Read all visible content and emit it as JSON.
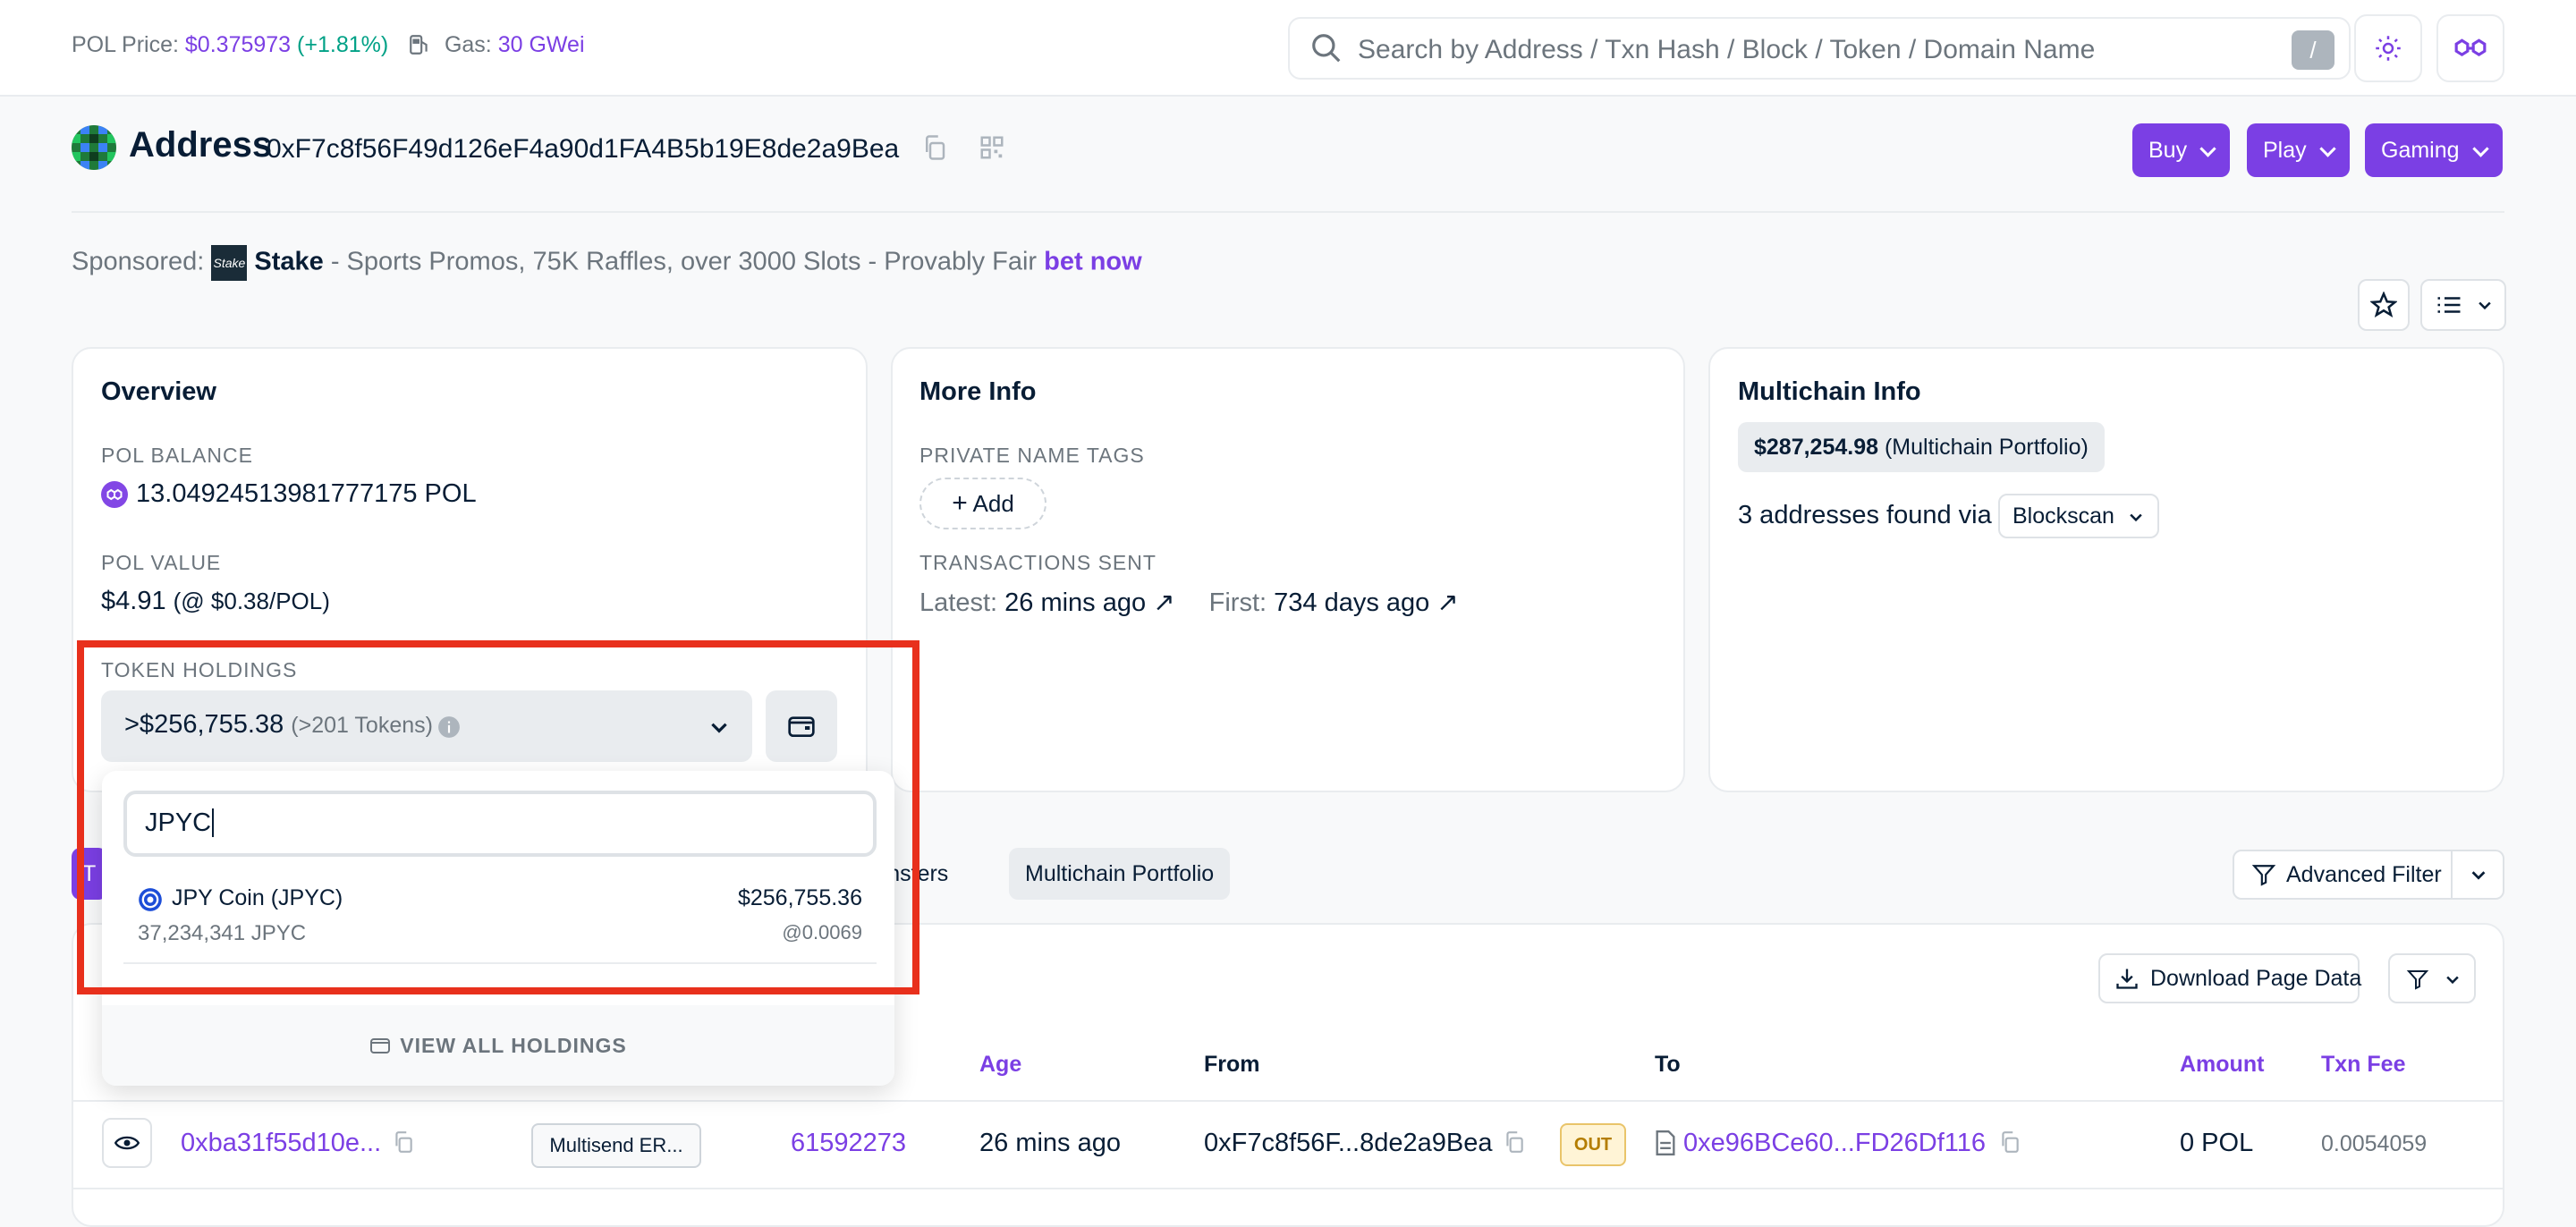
{
  "topbar": {
    "price_label": "POL Price:",
    "price_value": "$0.375973",
    "price_change": "(+1.81%)",
    "gas_label": "Gas:",
    "gas_value": "30 GWei",
    "search_placeholder": "Search by Address / Txn Hash / Block / Token / Domain Name",
    "search_shortcut": "/"
  },
  "header": {
    "title": "Address",
    "address": "0xF7c8f56F49d126eF4a90d1FA4B5b19E8de2a9Bea",
    "buttons": [
      "Buy",
      "Play",
      "Gaming"
    ]
  },
  "sponsor": {
    "label": "Sponsored:",
    "logo_text": "Stake",
    "brand": "Stake",
    "text": "- Sports Promos, 75K Raffles, over 3000 Slots - Provably Fair",
    "link": "bet now"
  },
  "overview": {
    "title": "Overview",
    "balance_label": "POL BALANCE",
    "balance_value": "13.04924513981777175 POL",
    "value_label": "POL VALUE",
    "value_value": "$4.91",
    "value_rate": "(@ $0.38/POL)",
    "holdings_label": "TOKEN HOLDINGS",
    "holdings_value": ">$256,755.38",
    "holdings_count": "(>201 Tokens)"
  },
  "dropdown": {
    "search_value": "JPYC",
    "token_name": "JPY Coin (JPYC)",
    "token_amount": "37,234,341 JPYC",
    "token_value": "$256,755.36",
    "token_rate": "@0.0069",
    "view_all": "VIEW ALL HOLDINGS"
  },
  "moreinfo": {
    "title": "More Info",
    "tags_label": "PRIVATE NAME TAGS",
    "add_label": "Add",
    "sent_label": "TRANSACTIONS SENT",
    "latest_label": "Latest:",
    "latest_value": "26 mins ago",
    "first_label": "First:",
    "first_value": "734 days ago"
  },
  "multichain": {
    "title": "Multichain Info",
    "portfolio_value": "$287,254.98",
    "portfolio_label": "(Multichain Portfolio)",
    "found_text": "3 addresses found via",
    "provider": "Blockscan"
  },
  "tabs": {
    "first_partial": "T",
    "transfers_partial": "ransfers",
    "multichain": "Multichain Portfolio",
    "advanced_filter": "Advanced Filter"
  },
  "table": {
    "download_label": "Download Page Data",
    "headers": {
      "age": "Age",
      "from": "From",
      "to": "To",
      "amount": "Amount",
      "fee": "Txn Fee"
    },
    "row": {
      "hash": "0xba31f55d10e...",
      "method": "Multisend ER...",
      "block": "61592273",
      "age": "26 mins ago",
      "from": "0xF7c8f56F...8de2a9Bea",
      "direction": "OUT",
      "to": "0xe96BCe60...FD26Df116",
      "amount": "0 POL",
      "fee": "0.0054059"
    }
  }
}
